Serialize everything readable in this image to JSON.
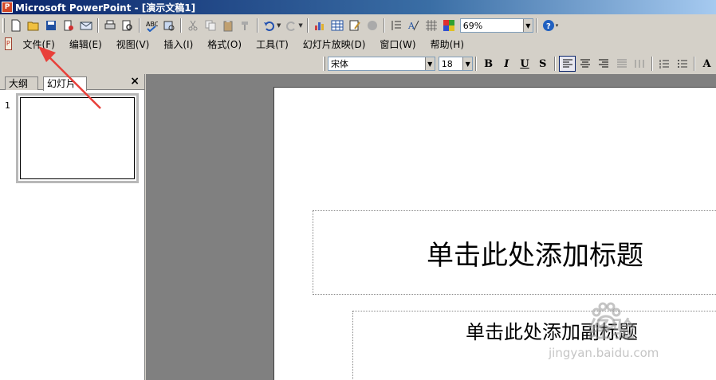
{
  "titlebar": {
    "title": "Microsoft PowerPoint - [演示文稿1]",
    "icon": "powerpoint-app-icon",
    "icon_glyph": "P"
  },
  "toolbar": {
    "buttons": [
      "new-icon",
      "open-icon",
      "save-icon",
      "permission-icon",
      "email-icon",
      "print-icon",
      "print-preview-icon",
      "spelling-icon",
      "research-icon",
      "cut-icon",
      "copy-icon",
      "paste-icon",
      "format-painter-icon",
      "undo-icon",
      "redo-icon",
      "insert-chart-icon",
      "insert-table-icon",
      "tables-borders-icon",
      "insert-hyperlink-icon",
      "expand-all-icon",
      "show-formatting-icon",
      "show-grid-icon",
      "color-grayscale-icon",
      "help-icon"
    ],
    "zoom_value": "69%"
  },
  "menubar": {
    "icon_glyph": "P",
    "items": [
      "文件(F)",
      "编辑(E)",
      "视图(V)",
      "插入(I)",
      "格式(O)",
      "工具(T)",
      "幻灯片放映(D)",
      "窗口(W)",
      "帮助(H)"
    ]
  },
  "format": {
    "font": "宋体",
    "size": "18",
    "bold": "B",
    "italic": "I",
    "underline": "U",
    "shadow": "S",
    "grow_font": "A"
  },
  "pane": {
    "tab_outline": "大纲",
    "tab_slides": "幻灯片",
    "close": "×",
    "slide_number": "1"
  },
  "slide": {
    "title_placeholder": "单击此处添加标题",
    "subtitle_placeholder": "单击此处添加副标题"
  },
  "watermark": {
    "main": "经验",
    "sub": "jingyan.baidu.com"
  },
  "annotation": {
    "arrow_color": "#e8403a"
  },
  "colors": {
    "titlebar_start": "#0a246a",
    "titlebar_end": "#a6caf0",
    "chrome": "#d4d0c8",
    "workspace": "#808080"
  }
}
